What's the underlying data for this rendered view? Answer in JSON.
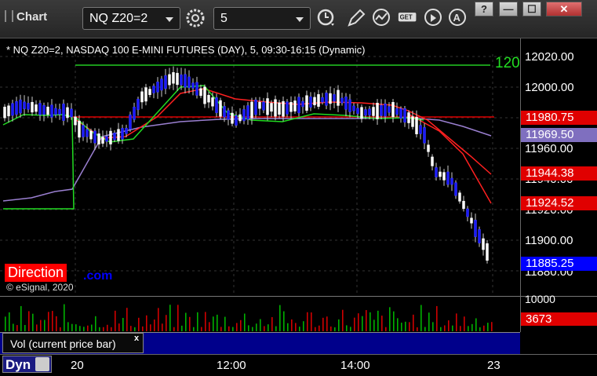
{
  "app": {
    "title": "Chart"
  },
  "toolbar": {
    "symbol": "NQ Z20=2",
    "interval": "5",
    "window_buttons": [
      "?",
      "—",
      "☐",
      "✕"
    ]
  },
  "chart": {
    "header": "* NQ Z20=2, NASDAQ 100 E-MINI FUTURES (DAY), 5, 09:30-16:15 (Dynamic)",
    "line_label": "120",
    "direction_label": "Direction",
    "direction_suffix": ".com",
    "copyright": "© eSignal, 2020",
    "y_ticks": [
      "12020.00",
      "12000.00",
      "11960.00",
      "11940.00",
      "11920.00",
      "11900.00",
      "11880.00"
    ],
    "price_tags": [
      {
        "label": "11980.75",
        "color": "#e00000"
      },
      {
        "label": "11969.50",
        "color": "#7f6fbf"
      },
      {
        "label": "11944.38",
        "color": "#e00000"
      },
      {
        "label": "11924.52",
        "color": "#e00000"
      },
      {
        "label": "11885.25",
        "color": "#0000ff"
      }
    ],
    "x_ticks": [
      "20",
      "12:00",
      "14:00",
      "23"
    ],
    "colors": {
      "up_candle": "#ffffff",
      "down_candle": "#1a1aff",
      "fast_ma": "#22dd22",
      "slow_ma": "#ff2020",
      "baseline": "#9a7fd0",
      "level_line": "#22cc22",
      "level_red": "#e00000"
    }
  },
  "volume": {
    "legend": "Vol (current price bar)",
    "close_label": "x",
    "y_tick": "10000",
    "current": "3673",
    "current_color": "#e00000"
  },
  "footer": {
    "dyn_label": "Dyn"
  }
}
